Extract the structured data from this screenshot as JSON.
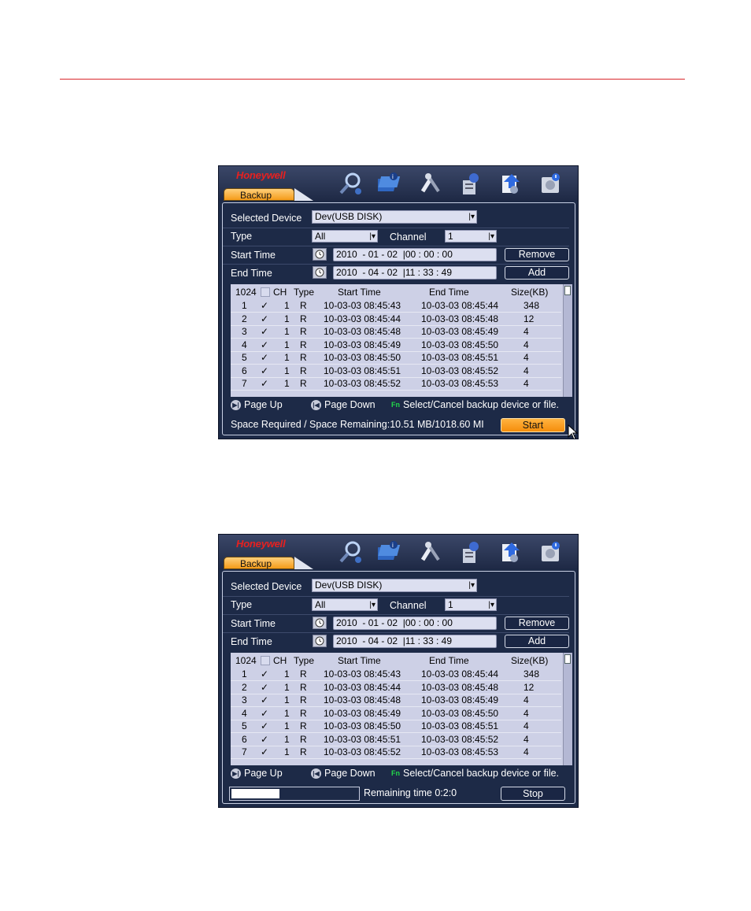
{
  "colors": {
    "accent": "#f59b18",
    "panel": "#1d2a47",
    "rule": "#d9262b",
    "brand": "#e8201f"
  },
  "screens": [
    {
      "brand": "Honeywell",
      "tab": "Backup",
      "selected_device_label": "Selected Device",
      "selected_device_value": "Dev(USB DISK)",
      "type_label": "Type",
      "type_value": "All",
      "channel_label": "Channel",
      "channel_value": "1",
      "start_time_label": "Start Time",
      "start_time_value": "2010  - 01 - 02  |00 : 00 : 00",
      "end_time_label": "End Time",
      "end_time_value": "2010  - 04 - 02  |11 : 33 : 49",
      "remove_label": "Remove",
      "add_label": "Add",
      "columns": [
        "1024",
        "",
        "CH",
        "Type",
        "Start Time",
        "End Time",
        "Size(KB)"
      ],
      "rows": [
        [
          "1",
          "✓",
          "1",
          "R",
          "10-03-03 08:45:43",
          "10-03-03 08:45:44",
          "348"
        ],
        [
          "2",
          "✓",
          "1",
          "R",
          "10-03-03 08:45:44",
          "10-03-03 08:45:48",
          "12"
        ],
        [
          "3",
          "✓",
          "1",
          "R",
          "10-03-03 08:45:48",
          "10-03-03 08:45:49",
          "4"
        ],
        [
          "4",
          "✓",
          "1",
          "R",
          "10-03-03 08:45:49",
          "10-03-03 08:45:50",
          "4"
        ],
        [
          "5",
          "✓",
          "1",
          "R",
          "10-03-03 08:45:50",
          "10-03-03 08:45:51",
          "4"
        ],
        [
          "6",
          "✓",
          "1",
          "R",
          "10-03-03 08:45:51",
          "10-03-03 08:45:52",
          "4"
        ],
        [
          "7",
          "✓",
          "1",
          "R",
          "10-03-03 08:45:52",
          "10-03-03 08:45:53",
          "4"
        ]
      ],
      "page_up": "Page Up",
      "page_down": "Page Down",
      "fn_hint": "Select/Cancel backup device or file.",
      "space_text": "Space Required / Space Remaining:10.51 MB/1018.60 MI",
      "start_label": "Start"
    },
    {
      "brand": "Honeywell",
      "tab": "Backup",
      "selected_device_label": "Selected Device",
      "selected_device_value": "Dev(USB DISK)",
      "type_label": "Type",
      "type_value": "All",
      "channel_label": "Channel",
      "channel_value": "1",
      "start_time_label": "Start Time",
      "start_time_value": "2010  - 01 - 02  |00 : 00 : 00",
      "end_time_label": "End Time",
      "end_time_value": "2010  - 04 - 02  |11 : 33 : 49",
      "remove_label": "Remove",
      "add_label": "Add",
      "columns": [
        "1024",
        "",
        "CH",
        "Type",
        "Start Time",
        "End Time",
        "Size(KB)"
      ],
      "rows": [
        [
          "1",
          "✓",
          "1",
          "R",
          "10-03-03 08:45:43",
          "10-03-03 08:45:44",
          "348"
        ],
        [
          "2",
          "✓",
          "1",
          "R",
          "10-03-03 08:45:44",
          "10-03-03 08:45:48",
          "12"
        ],
        [
          "3",
          "✓",
          "1",
          "R",
          "10-03-03 08:45:48",
          "10-03-03 08:45:49",
          "4"
        ],
        [
          "4",
          "✓",
          "1",
          "R",
          "10-03-03 08:45:49",
          "10-03-03 08:45:50",
          "4"
        ],
        [
          "5",
          "✓",
          "1",
          "R",
          "10-03-03 08:45:50",
          "10-03-03 08:45:51",
          "4"
        ],
        [
          "6",
          "✓",
          "1",
          "R",
          "10-03-03 08:45:51",
          "10-03-03 08:45:52",
          "4"
        ],
        [
          "7",
          "✓",
          "1",
          "R",
          "10-03-03 08:45:52",
          "10-03-03 08:45:53",
          "4"
        ]
      ],
      "page_up": "Page Up",
      "page_down": "Page Down",
      "fn_hint": "Select/Cancel backup device or file.",
      "progress_fraction": 0.38,
      "remaining_text": "Remaining time 0:2:0",
      "stop_label": "Stop"
    }
  ],
  "icons": [
    "search-icon",
    "info-icon",
    "tools-icon",
    "user-icon",
    "backup-icon",
    "disk-icon"
  ]
}
